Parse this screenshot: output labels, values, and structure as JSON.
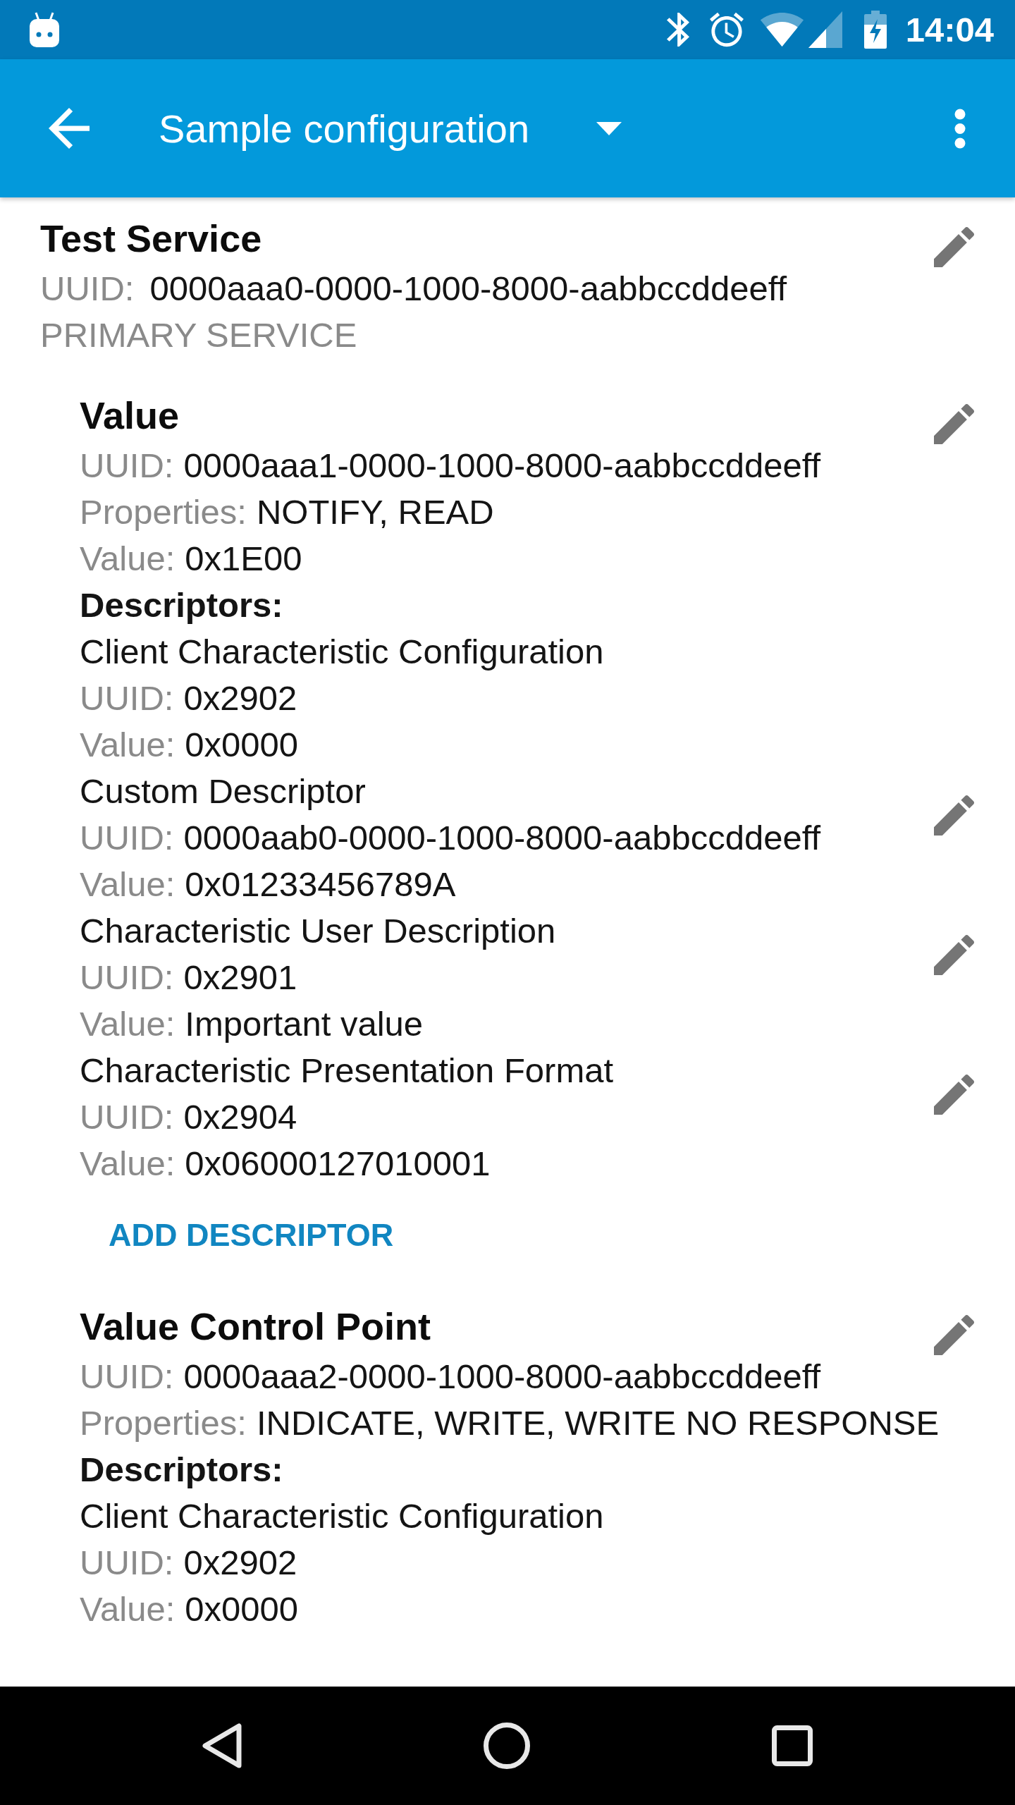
{
  "status_bar": {
    "time": "14:04"
  },
  "app_bar": {
    "title": "Sample configuration"
  },
  "service": {
    "name": "Test Service",
    "editable": true,
    "uuid_label": "UUID:",
    "uuid": "0000aaa0-0000-1000-8000-aabbccddeeff",
    "type": "PRIMARY SERVICE",
    "characteristics": [
      {
        "name": "Value",
        "editable": true,
        "fields": [
          {
            "label": "UUID:",
            "value": "0000aaa1-0000-1000-8000-aabbccddeeff"
          },
          {
            "label": "Properties:",
            "value": "NOTIFY, READ"
          },
          {
            "label": "Value:",
            "value": "0x1E00"
          }
        ],
        "descriptors_label": "Descriptors:",
        "descriptors": [
          {
            "name": "Client Characteristic Configuration",
            "editable": false,
            "fields": [
              {
                "label": "UUID:",
                "value": "0x2902"
              },
              {
                "label": "Value:",
                "value": "0x0000"
              }
            ]
          },
          {
            "name": "Custom Descriptor",
            "editable": true,
            "fields": [
              {
                "label": "UUID:",
                "value": "0000aab0-0000-1000-8000-aabbccddeeff"
              },
              {
                "label": "Value:",
                "value": "0x01233456789A"
              }
            ]
          },
          {
            "name": "Characteristic User Description",
            "editable": true,
            "fields": [
              {
                "label": "UUID:",
                "value": "0x2901"
              },
              {
                "label": "Value:",
                "value": "Important value"
              }
            ]
          },
          {
            "name": "Characteristic Presentation Format",
            "editable": true,
            "fields": [
              {
                "label": "UUID:",
                "value": "0x2904"
              },
              {
                "label": "Value:",
                "value": "0x06000127010001"
              }
            ]
          }
        ],
        "add_button": "ADD DESCRIPTOR"
      },
      {
        "name": "Value Control Point",
        "editable": true,
        "fields": [
          {
            "label": "UUID:",
            "value": "0000aaa2-0000-1000-8000-aabbccddeeff"
          },
          {
            "label": "Properties:",
            "value": "INDICATE, WRITE, WRITE NO RESPONSE"
          }
        ],
        "descriptors_label": "Descriptors:",
        "descriptors": [
          {
            "name": "Client Characteristic Configuration",
            "editable": false,
            "fields": [
              {
                "label": "UUID:",
                "value": "0x2902"
              },
              {
                "label": "Value:",
                "value": "0x0000"
              }
            ]
          }
        ]
      }
    ]
  }
}
